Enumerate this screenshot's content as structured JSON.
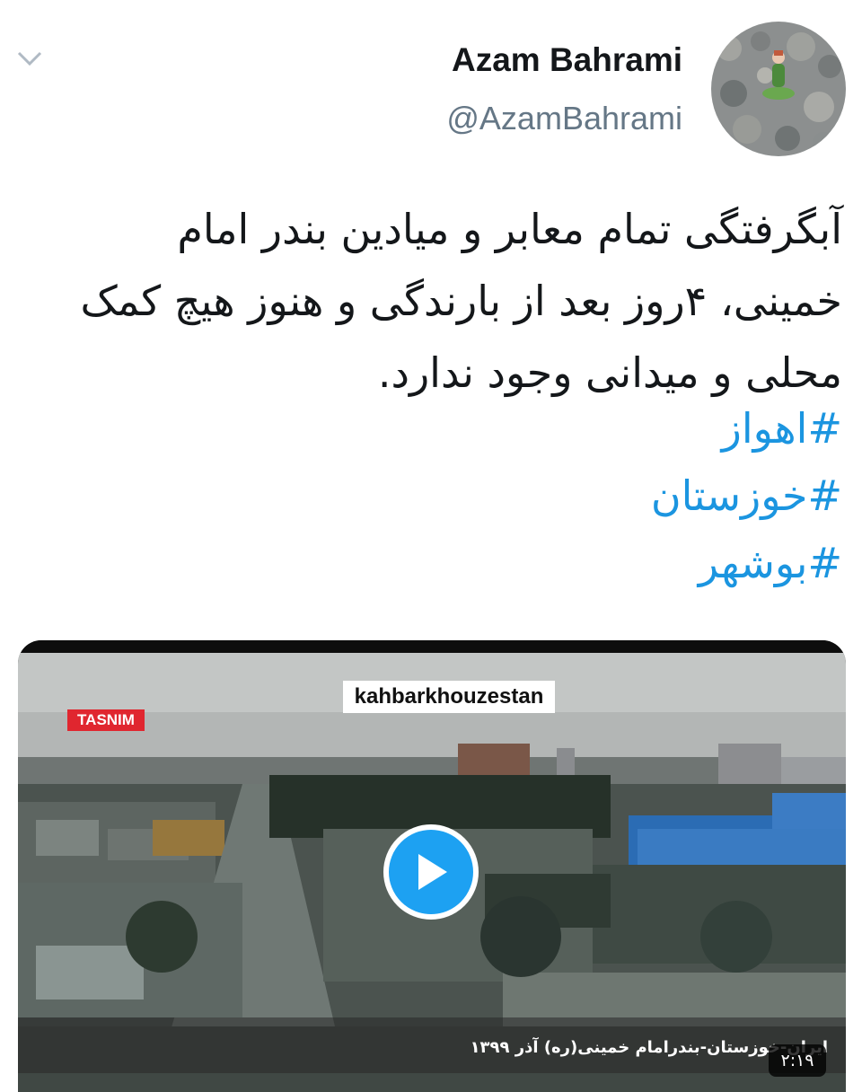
{
  "author": {
    "display_name": "Azam Bahrami",
    "handle": "@AzamBahrami"
  },
  "tweet": {
    "text": "آبگرفتگی تمام معابر و میادین بندر امام خمینی، ۴روز بعد از بارندگی و هنوز هیچ کمک محلی و میدانی وجود ندارد.",
    "hashtags": [
      "#اهواز",
      "#خوزستان",
      "#بوشهر"
    ]
  },
  "media": {
    "watermark": "kahbarkhouzestan",
    "channel_logo": "TASNIM",
    "caption": "ایران-خوزستان-بندرامام خمینی(ره) آذر ۱۳۹۹",
    "duration": "۲:۱۹"
  },
  "icons": {
    "menu": "chevron-down-icon",
    "play": "play-icon"
  },
  "colors": {
    "hashtag": "#1b95e0",
    "play_button": "#1da1f2",
    "text": "#14171a",
    "secondary_text": "#657786"
  }
}
